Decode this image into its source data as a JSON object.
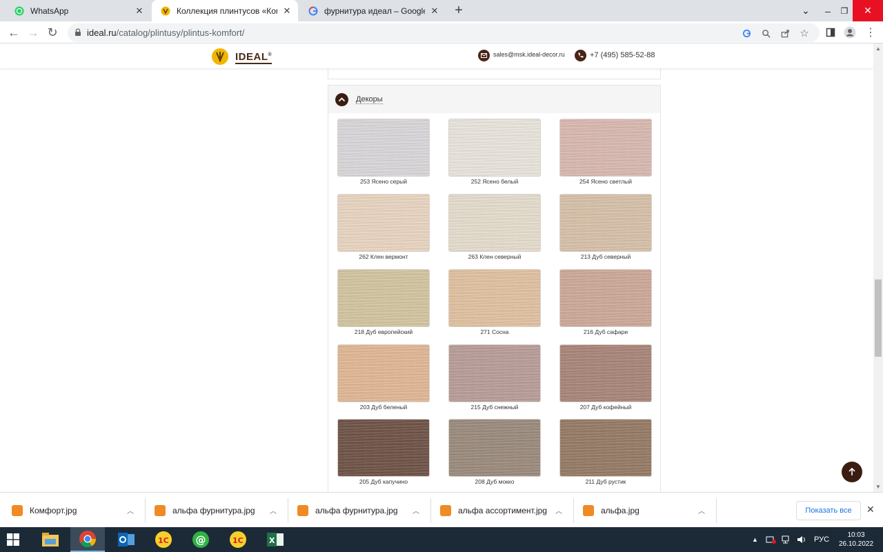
{
  "browser": {
    "tabs": [
      {
        "title": "WhatsApp",
        "active": false
      },
      {
        "title": "Коллекция плинтусов «Комфор",
        "active": true
      },
      {
        "title": "фурнитура идеал – Google Поиск",
        "active": false
      }
    ],
    "url_host": "ideal.ru",
    "url_path": "/catalog/plintusy/plintus-komfort/"
  },
  "site": {
    "logo_text": "IDEAL",
    "logo_reg": "®",
    "email": "sales@msk.ideal-decor.ru",
    "phone": "+7 (495) 585-52-88"
  },
  "section": {
    "title": "Декоры",
    "swatches": [
      {
        "label": "253 Ясено серый",
        "color": "#d8d6d8"
      },
      {
        "label": "252 Ясено белый",
        "color": "#e8e4dc"
      },
      {
        "label": "254 Ясено светлый",
        "color": "#d8b8b0"
      },
      {
        "label": "262 Клен вермонт",
        "color": "#e8d4c0"
      },
      {
        "label": "263 Клен северный",
        "color": "#e4dccc"
      },
      {
        "label": "213 Дуб северный",
        "color": "#d6c0a8"
      },
      {
        "label": "218 Дуб европейский",
        "color": "#d2c4a0"
      },
      {
        "label": "271 Сосна",
        "color": "#e0c0a0"
      },
      {
        "label": "216 Дуб сафари",
        "color": "#cca898"
      },
      {
        "label": "203 Дуб беленый",
        "color": "#e0b694"
      },
      {
        "label": "215 Дуб снежный",
        "color": "#b89c98"
      },
      {
        "label": "207 Дуб кофейный",
        "color": "#a88478"
      },
      {
        "label": "205 Дуб капучино",
        "color": "#6e5246"
      },
      {
        "label": "208 Дуб мокко",
        "color": "#9a8a7c"
      },
      {
        "label": "211 Дуб рустик",
        "color": "#947a64"
      }
    ]
  },
  "downloads": {
    "items": [
      {
        "name": "Комфорт.jpg"
      },
      {
        "name": "альфа фурнитура.jpg"
      },
      {
        "name": "альфа фурнитура.jpg"
      },
      {
        "name": "альфа ассортимент.jpg"
      },
      {
        "name": "альфа.jpg"
      }
    ],
    "show_all_label": "Показать все"
  },
  "taskbar": {
    "language": "РУС",
    "time": "10:03",
    "date": "26.10.2022"
  },
  "colors": {
    "brand_brown": "#3b1d12",
    "brand_yellow": "#f2b600",
    "download_icon": "#f08a24"
  }
}
